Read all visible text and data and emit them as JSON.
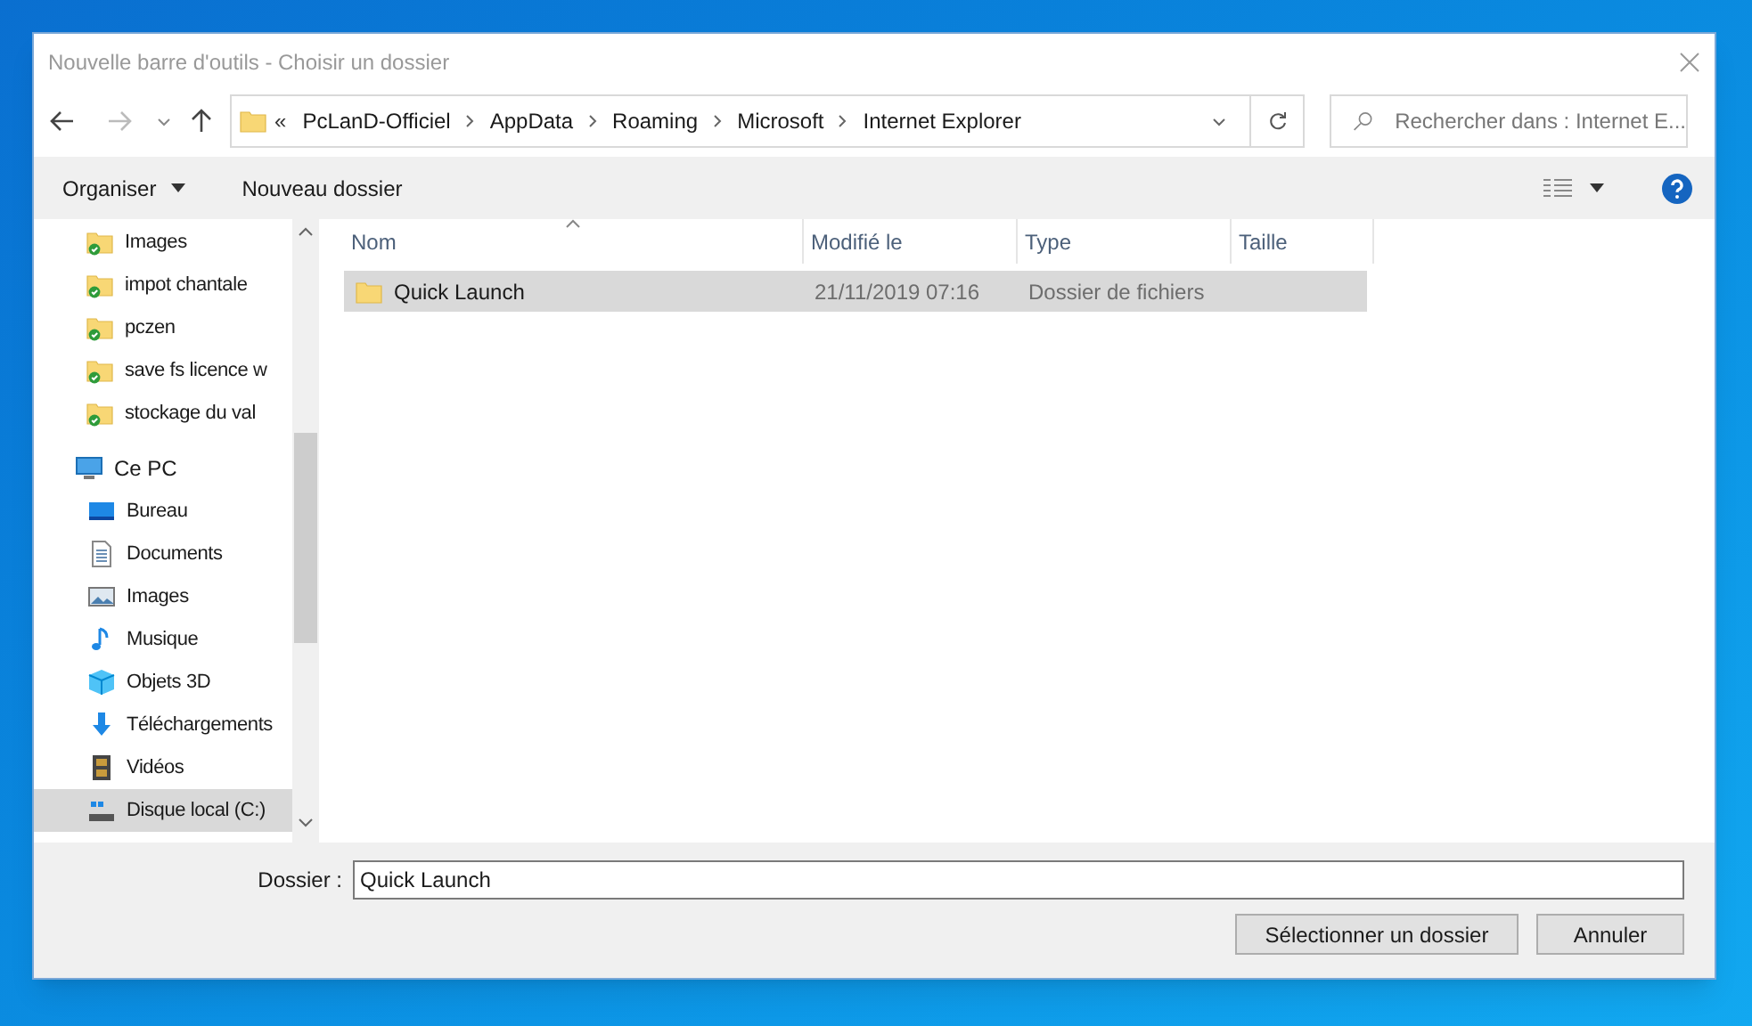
{
  "window": {
    "title": "Nouvelle barre d'outils - Choisir un dossier"
  },
  "address": {
    "overflow": "«",
    "crumbs": [
      "PcLanD-Officiel",
      "AppData",
      "Roaming",
      "Microsoft",
      "Internet Explorer"
    ]
  },
  "search": {
    "placeholder": "Rechercher dans : Internet E..."
  },
  "toolbar": {
    "organize": "Organiser",
    "new_folder": "Nouveau dossier"
  },
  "sidebar": {
    "items": [
      {
        "label": "Images",
        "kind": "synced",
        "selected": false
      },
      {
        "label": "impot chantale",
        "kind": "synced",
        "selected": false
      },
      {
        "label": "pczen",
        "kind": "synced",
        "selected": false
      },
      {
        "label": "save fs licence w",
        "kind": "synced",
        "selected": false
      },
      {
        "label": "stockage du val",
        "kind": "synced",
        "selected": false
      },
      {
        "label": "Ce PC",
        "kind": "pc",
        "selected": false,
        "children": [
          {
            "label": "Bureau",
            "kind": "desktop",
            "selected": false
          },
          {
            "label": "Documents",
            "kind": "documents",
            "selected": false
          },
          {
            "label": "Images",
            "kind": "pictures",
            "selected": false
          },
          {
            "label": "Musique",
            "kind": "music",
            "selected": false
          },
          {
            "label": "Objets 3D",
            "kind": "objects3d",
            "selected": false
          },
          {
            "label": "Téléchargements",
            "kind": "downloads",
            "selected": false
          },
          {
            "label": "Vidéos",
            "kind": "videos",
            "selected": false
          },
          {
            "label": "Disque local (C:)",
            "kind": "drive",
            "selected": true
          }
        ]
      }
    ]
  },
  "table": {
    "columns": [
      "Nom",
      "Modifié le",
      "Type",
      "Taille"
    ],
    "rows": [
      {
        "name": "Quick Launch",
        "modified": "21/11/2019 07:16",
        "type": "Dossier de fichiers",
        "selected": true
      }
    ]
  },
  "footer": {
    "folder_label": "Dossier :",
    "folder_value": "Quick Launch",
    "buttons": [
      "Sélectionner un dossier",
      "Annuler"
    ]
  }
}
